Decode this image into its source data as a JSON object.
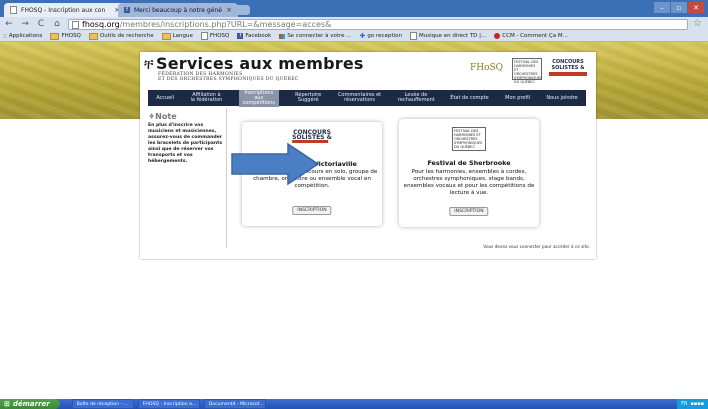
{
  "browser": {
    "tabs": [
      {
        "label": "FHOSQ - Inscription aux con",
        "active": true
      },
      {
        "label": "Merci beaucoup à notre géné",
        "active": false
      }
    ],
    "url_host": "fhosq.org",
    "url_path": "/membres/inscriptions.php?URL=&message=acces&",
    "window_buttons": [
      "–",
      "▫",
      "✕"
    ]
  },
  "bookmarks": [
    {
      "label": "Applications",
      "icon": "apps-icon"
    },
    {
      "label": "FHOSQ",
      "icon": "folder-icon"
    },
    {
      "label": "Outils de recherche",
      "icon": "folder-icon"
    },
    {
      "label": "Langue",
      "icon": "folder-icon"
    },
    {
      "label": "FHOSQ",
      "icon": "doc-icon"
    },
    {
      "label": "Facebook",
      "icon": "facebook-icon"
    },
    {
      "label": "Se connecter à votre ...",
      "icon": "mail-icon"
    },
    {
      "label": "go reception",
      "icon": "star-icon"
    },
    {
      "label": "Musique en direct TD |...",
      "icon": "doc-icon"
    },
    {
      "label": "CCM - Comment Ça M...",
      "icon": "ccm-icon"
    }
  ],
  "site": {
    "title": "Services aux membres",
    "subtitle_line1": "FÉDÉRATION DES HARMONIES",
    "subtitle_line2": "ET DES ORCHESTRES SYMPHONIQUES DU QUÉBEC",
    "fhosq_logo": "FHoSQ",
    "festival_logo": "FESTIVAL DES HARMONIES ET ORCHESTRES SYMPHONIQUES DU QUÉBEC",
    "concours_logo_top": "CONCOURS",
    "concours_logo_bottom": "SOLISTES &",
    "menu": [
      "Accueil",
      "Affiliation à la fédération",
      "Inscriptions aux compétitions",
      "Répertoire Suggéré",
      "Commentaires et réservations",
      "Levée de rechauffement",
      "État de compte",
      "Mon profil",
      "Nous joindre"
    ],
    "menu_selected": 2,
    "note_title": "Note",
    "note_body": "En plus d'inscrire vos musiciens et musiciennes, assurez-vous de commander les bracelets de participants ainsi que de réserver vos transports et vos hébergements.",
    "footer": "Vous devez vous connecter pour accéder à ce site."
  },
  "cards": [
    {
      "logo_top": "CONCOURS",
      "logo_bottom": "SOLISTES &",
      "title": "Concours de Victoriaville",
      "desc": "Pour participer au concours en solo, groupe de chambre, orchestre ou ensemble vocal en compétition.",
      "button": "INSCRIPTION"
    },
    {
      "logo": "FESTIVAL DES HARMONIES ET ORCHESTRES SYMPHONIQUES DU QUÉBEC",
      "title": "Festival de Sherbrooke",
      "desc": "Pour les harmonies, ensembles à cordes, orchestres symphoniques, stage bands, ensembles vocaux et pour les compétitions de lecture à vue.",
      "button": "INSCRIPTION"
    }
  ],
  "taskbar": {
    "start": "démarrer",
    "tasks": [
      "Boîte de réception - ...",
      "FHOSQ - Inscription a...",
      "Document4 - Microsof..."
    ],
    "tray": "FR"
  },
  "colors": {
    "menu_bg": "#1c2a45",
    "banner": "#b4a634",
    "arrow": "#4a7fc4"
  }
}
